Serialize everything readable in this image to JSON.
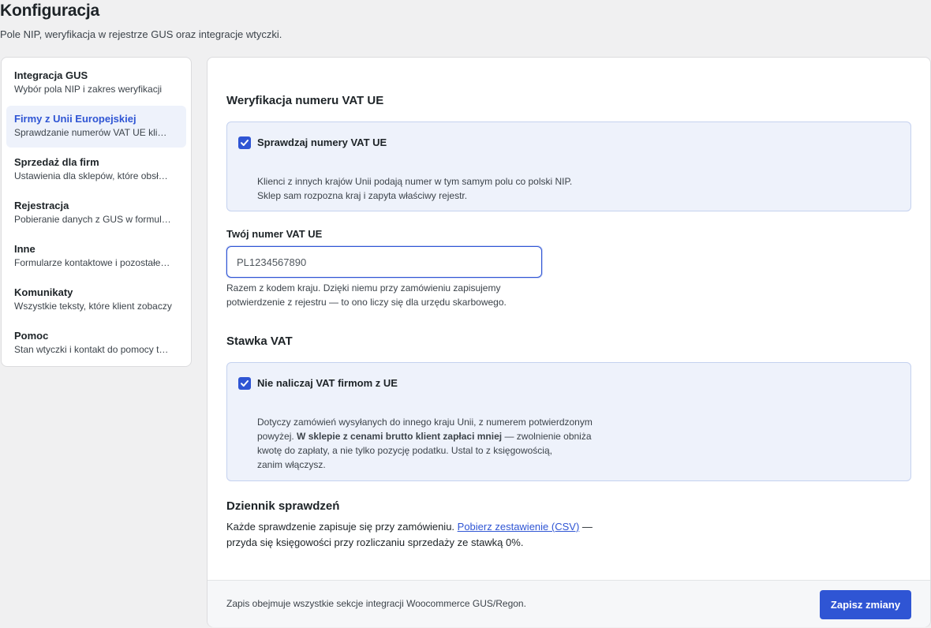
{
  "header": {
    "title": "Konfiguracja",
    "subtitle": "Pole NIP, weryfikacja w rejestrze GUS oraz integracje wtyczki."
  },
  "sidebar": {
    "items": [
      {
        "title": "Integracja GUS",
        "desc": "Wybór pola NIP i zakres weryfikacji"
      },
      {
        "title": "Firmy z Unii Europejskiej",
        "desc": "Sprawdzanie numerów VAT UE klientów"
      },
      {
        "title": "Sprzedaż dla firm",
        "desc": "Ustawienia dla sklepów, które obsługują firmy"
      },
      {
        "title": "Rejestracja",
        "desc": "Pobieranie danych z GUS w formularzu"
      },
      {
        "title": "Inne",
        "desc": "Formularze kontaktowe i pozostałe integracje"
      },
      {
        "title": "Komunikaty",
        "desc": "Wszystkie teksty, które klient zobaczy"
      },
      {
        "title": "Pomoc",
        "desc": "Stan wtyczki i kontakt do pomocy technicznej"
      }
    ],
    "active_index": 1
  },
  "main": {
    "vat_section": {
      "title": "Weryfikacja numeru VAT UE",
      "option_label": "Sprawdzaj numery VAT UE",
      "option_checked": true,
      "option_desc_line1": "Klienci z innych krajów Unii podają numer w tym samym polu co polski NIP.",
      "option_desc_line2": "Sklep sam rozpozna kraj i zapyta właściwy rejestr."
    },
    "vat_field": {
      "label": "Twój numer VAT UE",
      "value": "PL1234567890",
      "help_line1": "Razem z kodem kraju. Dzięki niemu przy zamówieniu zapisujemy",
      "help_line2": "potwierdzenie z rejestru — to ono liczy się dla urzędu skarbowego."
    },
    "rate_section": {
      "title": "Stawka VAT",
      "option_label": "Nie naliczaj VAT firmom z UE",
      "option_checked": true,
      "desc_line1": "Dotyczy zamówień wysyłanych do innego kraju Unii, z numerem potwierdzonym",
      "desc_line2_pre": "powyżej. ",
      "desc_line2_bold": "W sklepie z cenami brutto klient zapłaci mniej",
      "desc_line2_post": " — zwolnienie obniża",
      "desc_line3": "kwotę do zapłaty, a nie tylko pozycję podatku. Ustal to z księgowością,",
      "desc_line4": "zanim włączysz."
    },
    "log_section": {
      "title": "Dziennik sprawdzeń",
      "text_pre": "Każde sprawdzenie zapisuje się przy zamówieniu. ",
      "link": "Pobierz zestawienie (CSV)",
      "text_post": " —",
      "line2": "przyda się księgowości przy rozliczaniu sprzedaży ze stawką 0%."
    },
    "footer": {
      "note": "Zapis obejmuje wszystkie sekcje integracji Woocommerce GUS/Regon.",
      "save_label": "Zapisz zmiany"
    }
  },
  "colors": {
    "accent": "#2f55d4",
    "option_bg": "#eef2fb",
    "page_bg": "#f0f0f1"
  }
}
